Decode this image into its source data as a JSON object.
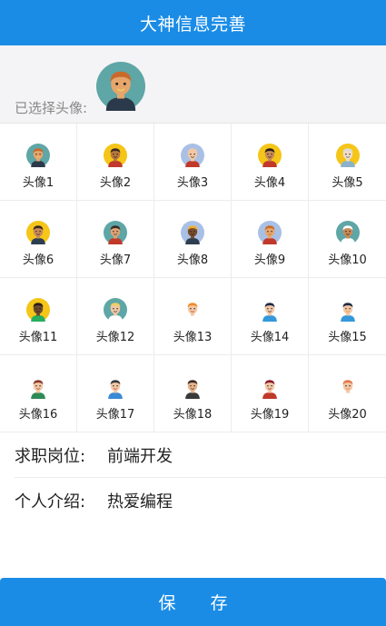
{
  "header": {
    "title": "大神信息完善"
  },
  "selected": {
    "label": "已选择头像:",
    "avatar_index": 0
  },
  "avatars": [
    {
      "label": "头像1",
      "bg": "#5fa6a6",
      "skin": "#e6a56b",
      "hair": "#c96a2a",
      "shirt": "#2b3a4a",
      "accent": "#f0d060"
    },
    {
      "label": "头像2",
      "bg": "#f5c518",
      "skin": "#b9773d",
      "hair": "#3b2a20",
      "shirt": "#c0392b",
      "accent": "#1f1f1f"
    },
    {
      "label": "头像3",
      "bg": "#a9c0e6",
      "skin": "#f2c7a5",
      "hair": "#f2c7a5",
      "shirt": "#c0392b",
      "accent": "#333333"
    },
    {
      "label": "头像4",
      "bg": "#f5c518",
      "skin": "#c98a57",
      "hair": "#2a1e18",
      "shirt": "#c0392b",
      "accent": "#2a1e18"
    },
    {
      "label": "头像5",
      "bg": "#f5c518",
      "skin": "#f0dcc8",
      "hair": "#dcdcdc",
      "shirt": "#8bb2c8",
      "accent": "#555555"
    },
    {
      "label": "头像6",
      "bg": "#f5c518",
      "skin": "#c98a57",
      "hair": "#3a2a22",
      "shirt": "#2c3e50",
      "accent": "#3a2a22"
    },
    {
      "label": "头像7",
      "bg": "#5fa6a6",
      "skin": "#e0a273",
      "hair": "#3a2a22",
      "shirt": "#c0392b",
      "accent": "#333333"
    },
    {
      "label": "头像8",
      "bg": "#a9c0e6",
      "skin": "#7a4b2a",
      "hair": "#f0b030",
      "shirt": "#2c3e50",
      "accent": "#222222"
    },
    {
      "label": "头像9",
      "bg": "#a9c0e6",
      "skin": "#e6a56b",
      "hair": "#c96a2a",
      "shirt": "#c0392b",
      "accent": "#c96a2a"
    },
    {
      "label": "头像10",
      "bg": "#5fa6a6",
      "skin": "#c98a57",
      "hair": "#ffffff",
      "shirt": "#ffffff",
      "accent": "#2a1e18"
    },
    {
      "label": "头像11",
      "bg": "#f5c518",
      "skin": "#6b4a2e",
      "hair": "#2a1e18",
      "shirt": "#27ae60",
      "accent": "#2a1e18"
    },
    {
      "label": "头像12",
      "bg": "#5fa6a6",
      "skin": "#f2c7a5",
      "hair": "#f0d060",
      "shirt": "#ffffff",
      "accent": "#333333"
    },
    {
      "label": "头像13",
      "bg": "#ffffff",
      "skin": "#f2c7a5",
      "hair": "#f08a2a",
      "shirt": "#ffffff",
      "accent": "#c0392b"
    },
    {
      "label": "头像14",
      "bg": "#ffffff",
      "skin": "#f2c7a5",
      "hair": "#1f2a44",
      "shirt": "#3498db",
      "accent": "#1f2a44"
    },
    {
      "label": "头像15",
      "bg": "#ffffff",
      "skin": "#f2c7a5",
      "hair": "#1f2a44",
      "shirt": "#3498db",
      "accent": "#f08a2a"
    },
    {
      "label": "头像16",
      "bg": "#ffffff",
      "skin": "#f2c7a5",
      "hair": "#8b3a2a",
      "shirt": "#2e8b57",
      "accent": "#8b3a2a"
    },
    {
      "label": "头像17",
      "bg": "#ffffff",
      "skin": "#f2c7a5",
      "hair": "#3a3a3a",
      "shirt": "#3a8ad6",
      "accent": "#c0392b"
    },
    {
      "label": "头像18",
      "bg": "#ffffff",
      "skin": "#e6b48a",
      "hair": "#3a2a22",
      "shirt": "#3a3a3a",
      "accent": "#3a2a22"
    },
    {
      "label": "头像19",
      "bg": "#ffffff",
      "skin": "#f2c7a5",
      "hair": "#8b1a2a",
      "shirt": "#c0392b",
      "accent": "#8b1a2a"
    },
    {
      "label": "头像20",
      "bg": "#ffffff",
      "skin": "#f2c7a5",
      "hair": "#e07a4a",
      "shirt": "#ffffff",
      "accent": "#e07a4a"
    }
  ],
  "form": {
    "position_label": "求职岗位:",
    "position_value": "前端开发",
    "intro_label": "个人介绍:",
    "intro_value": "热爱编程"
  },
  "save_label": "保 存"
}
